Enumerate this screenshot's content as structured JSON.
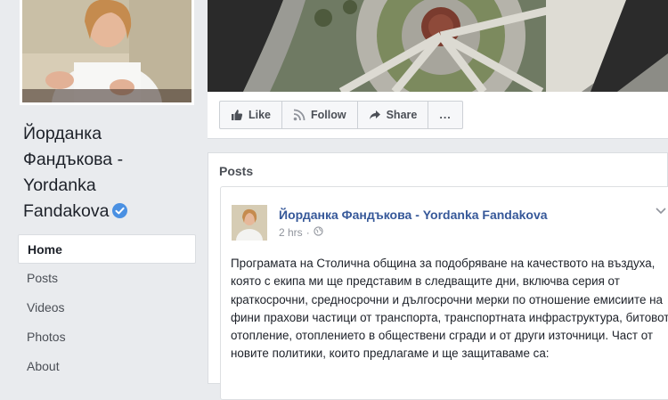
{
  "page": {
    "name": "Йорданка Фандъкова - Yordanka Fandakova",
    "name_lines": [
      "Йорданка",
      "Фандъкова -",
      "Yordanka",
      "Fandakova"
    ]
  },
  "nav": {
    "items": [
      {
        "label": "Home",
        "active": true
      },
      {
        "label": "Posts"
      },
      {
        "label": "Videos"
      },
      {
        "label": "Photos"
      },
      {
        "label": "About"
      }
    ]
  },
  "actions": {
    "like": "Like",
    "follow": "Follow",
    "share": "Share",
    "more": "..."
  },
  "posts": {
    "section_title": "Posts",
    "items": [
      {
        "author": "Йорданка Фандъкова - Yordanka Fandakova",
        "time": "2 hrs",
        "text": "Програмата на Столична община за подобряване на качеството на въздуха, която с екипа ми ще представим в следващите дни, включва серия от краткосрочни, средносрочни и дългосрочни мерки по отношение емисиите на фини прахови частици от транспорта, транспортната инфраструктура, битовото отопление, отоплението в обществени сгради и от други източници. Част от новите политики, които предлагаме и ще защитаваме са:"
      }
    ]
  },
  "colors": {
    "background": "#e9ebee",
    "link": "#365899",
    "verified": "#4a90e2"
  },
  "icons": {
    "like": "thumbs-up-icon",
    "follow": "rss-icon",
    "share": "share-arrow-icon",
    "verified": "verified-badge-icon",
    "privacy": "globe-icon"
  }
}
